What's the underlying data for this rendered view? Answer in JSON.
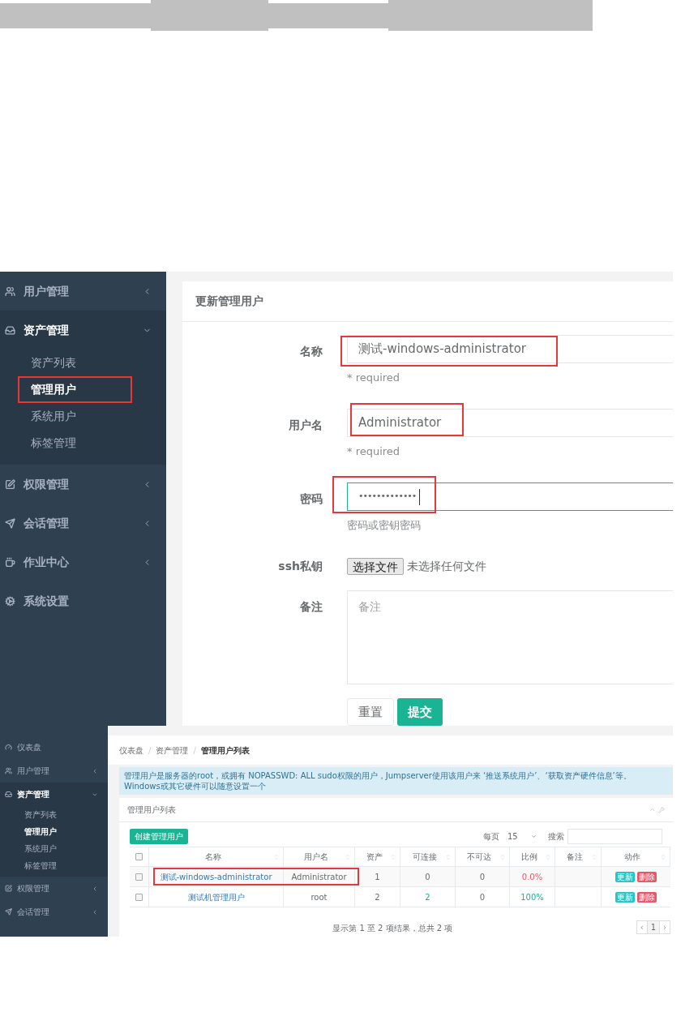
{
  "upper_screenshot": {
    "sidebar": [
      {
        "label": "用户管理",
        "kind": "group",
        "expanded": false
      },
      {
        "label": "资产管理",
        "kind": "group",
        "expanded": true,
        "children": [
          {
            "label": "资产列表",
            "selected": false,
            "highlighted": false
          },
          {
            "label": "管理用户",
            "selected": true,
            "highlighted": true
          },
          {
            "label": "系统用户",
            "selected": false,
            "highlighted": false
          },
          {
            "label": "标签管理",
            "selected": false,
            "highlighted": false
          }
        ]
      },
      {
        "label": "权限管理",
        "kind": "group",
        "expanded": false
      },
      {
        "label": "会话管理",
        "kind": "group",
        "expanded": false
      },
      {
        "label": "作业中心",
        "kind": "group",
        "expanded": false
      },
      {
        "label": "系统设置",
        "kind": "link"
      }
    ],
    "card_title": "更新管理用户",
    "fields": [
      {
        "kind": "text",
        "label": "名称",
        "value": "测试-windows-administrator",
        "help": "* required",
        "highlighted": true,
        "focused": false
      },
      {
        "kind": "text",
        "label": "用户名",
        "value": "Administrator",
        "help": "* required",
        "highlighted": true,
        "focused": false
      },
      {
        "kind": "password",
        "label": "密码",
        "value": "•••••••••••••",
        "help": "密码或密钥密码",
        "highlighted": true,
        "focused": true
      },
      {
        "kind": "file",
        "label": "ssh私钥",
        "button": "选择文件",
        "status": "未选择任何文件"
      },
      {
        "kind": "textarea",
        "label": "备注",
        "placeholder": "备注"
      }
    ],
    "buttons": [
      {
        "label": "重置",
        "kind": "default"
      },
      {
        "label": "提交",
        "kind": "primary"
      }
    ]
  },
  "lower_screenshot": {
    "sidebar": [
      {
        "label": "仪表盘",
        "kind": "link"
      },
      {
        "label": "用户管理",
        "kind": "group",
        "expanded": false
      },
      {
        "label": "资产管理",
        "kind": "group",
        "expanded": true,
        "children": [
          {
            "label": "资产列表",
            "selected": false,
            "highlighted": false
          },
          {
            "label": "管理用户",
            "selected": true,
            "highlighted": false
          },
          {
            "label": "系统用户",
            "selected": false,
            "highlighted": false
          },
          {
            "label": "标签管理",
            "selected": false,
            "highlighted": false
          }
        ]
      },
      {
        "label": "权限管理",
        "kind": "group",
        "expanded": false
      },
      {
        "label": "会话管理",
        "kind": "group",
        "expanded": false
      }
    ],
    "breadcrumb": [
      "仪表盘",
      "资产管理",
      "管理用户列表"
    ],
    "breadcrumb_separator": "/",
    "alert": "管理用户是服务器的root，或拥有 NOPASSWD: ALL sudo权限的用户，Jumpserver使用该用户来 ‘推送系统用户’、‘获取资产硬件信息’等。 Windows或其它硬件可以随意设置一个",
    "card_title": "管理用户列表",
    "create_button": "创建管理用户",
    "page_size_label": "每页",
    "page_size": "15",
    "search_label": "搜索",
    "table": {
      "select_all_checked": false,
      "columns": [
        "名称",
        "用户名",
        "资产",
        "可连接",
        "不可达",
        "比例",
        "备注",
        "动作"
      ],
      "rows": [
        {
          "checked": false,
          "highlighted": true,
          "name": "测试-windows-administrator",
          "username": "Administrator",
          "assets": "1",
          "reachable": "0",
          "all_reachable": false,
          "unreachable": "0",
          "ratio": "0.0%",
          "actions": [
            "更新",
            "删除"
          ]
        },
        {
          "checked": false,
          "highlighted": false,
          "name": "测试机管理用户",
          "username": "root",
          "assets": "2",
          "reachable": "2",
          "all_reachable": true,
          "unreachable": "0",
          "ratio": "100%",
          "actions": [
            "更新",
            "删除"
          ]
        }
      ]
    },
    "footer": "显示第 1 至 2 项结果，总共 2 项",
    "pagination": {
      "prev": "‹",
      "next": "›",
      "pages": [
        {
          "label": "1",
          "selected": true
        }
      ]
    }
  }
}
